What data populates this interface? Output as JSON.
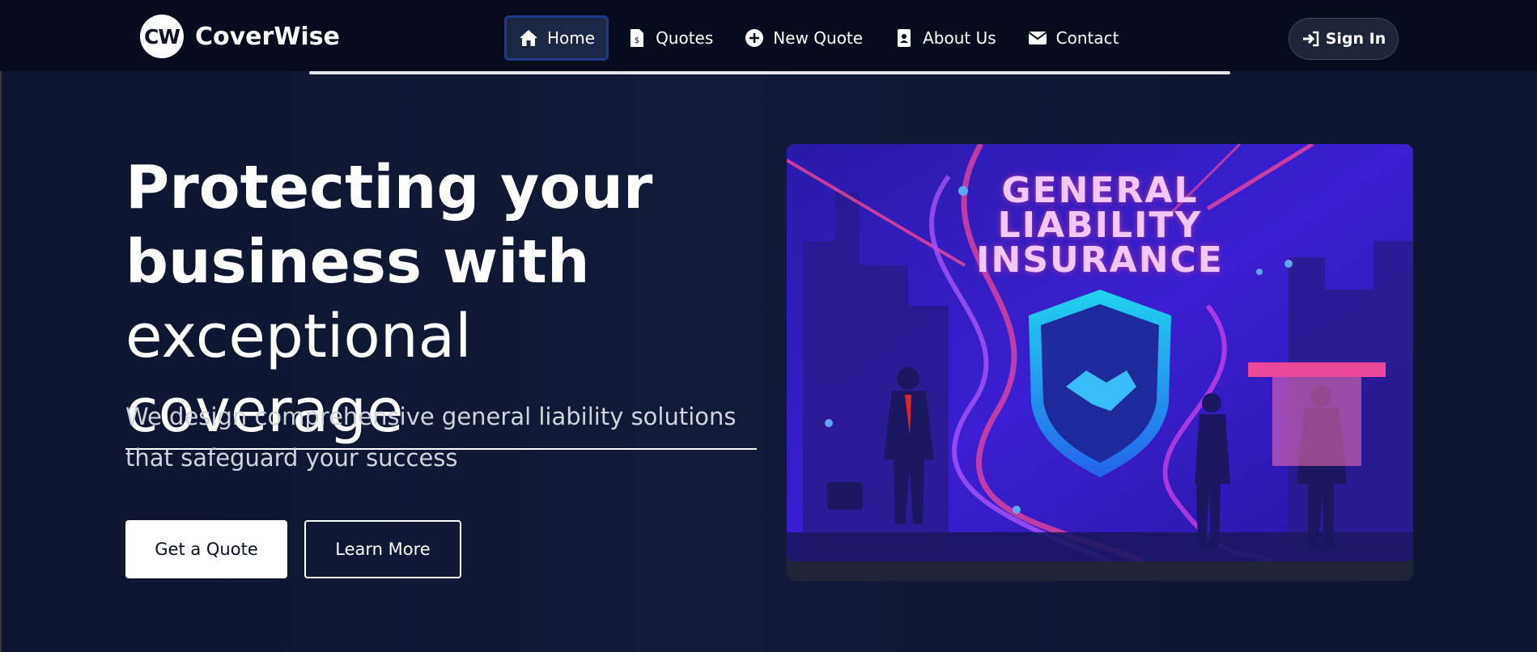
{
  "brand": {
    "logo_text": "CW",
    "name": "CoverWise"
  },
  "nav": {
    "items": [
      {
        "label": "Home",
        "icon": "home-icon",
        "active": true
      },
      {
        "label": "Quotes",
        "icon": "invoice-icon",
        "active": false
      },
      {
        "label": "New Quote",
        "icon": "plus-circle-icon",
        "active": false
      },
      {
        "label": "About Us",
        "icon": "id-badge-icon",
        "active": false
      },
      {
        "label": "Contact",
        "icon": "envelope-icon",
        "active": false
      }
    ],
    "signin": {
      "label": "Sign In",
      "icon": "sign-in-icon"
    }
  },
  "hero": {
    "title_line1": "Protecting your",
    "title_line2": "business with",
    "title_line3": "exceptional coverage",
    "subtitle": "We design comprehensive general liability solutions that safeguard your success",
    "primary_button": "Get a Quote",
    "secondary_button": "Learn More"
  },
  "illustration": {
    "line1": "GENERAL",
    "line2": "LIABILITY",
    "line3": "INSURANCE"
  },
  "colors": {
    "background": "#0d1530",
    "navbar": "#070c1d",
    "accent_blue": "#1e3a8a",
    "illustration_purple": "#3b1fd1",
    "illustration_pink": "#ec4899"
  }
}
